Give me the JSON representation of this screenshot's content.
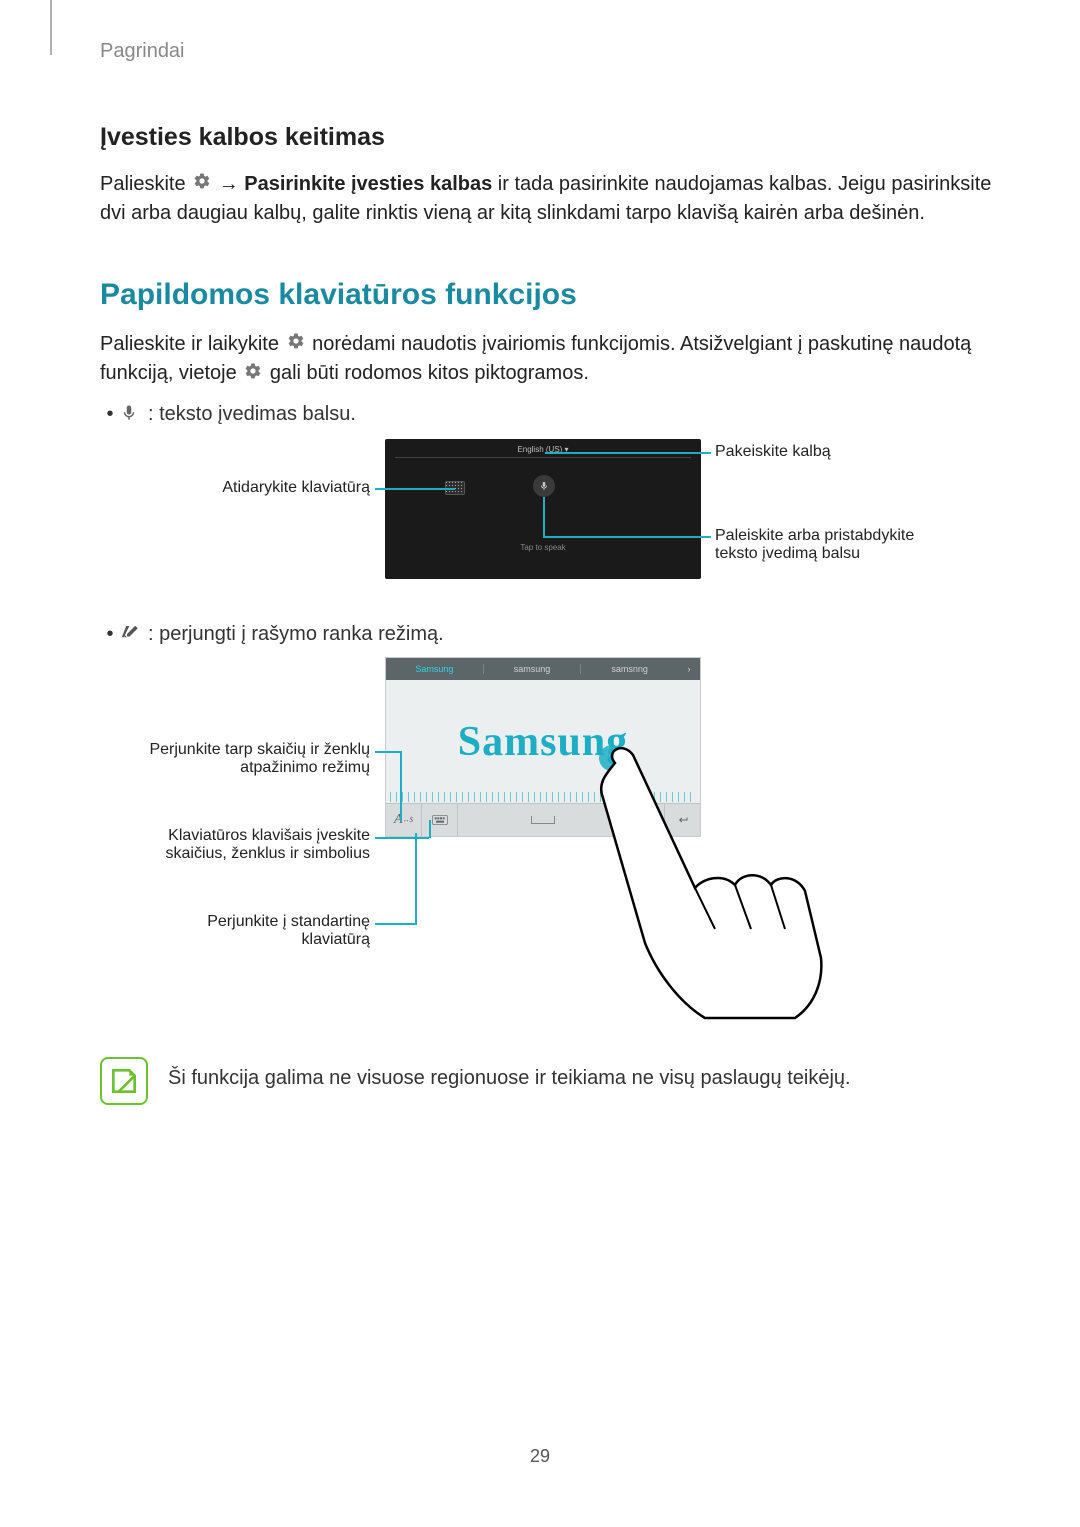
{
  "header": "Pagrindai",
  "section1_title": "Įvesties kalbos keitimas",
  "section1_p1_a": "Palieskite ",
  "section1_p1_b": " → ",
  "section1_p1_bold": "Pasirinkite įvesties kalbas",
  "section1_p1_c": " ir tada pasirinkite naudojamas kalbas. Jeigu pasirinksite dvi arba daugiau kalbų, galite rinktis vieną ar kitą slinkdami tarpo klavišą kairėn arba dešinėn.",
  "section2_title": "Papildomos klaviatūros funkcijos",
  "section2_p1_a": "Palieskite ir laikykite ",
  "section2_p1_b": " norėdami naudotis įvairiomis funkcijomis. Atsižvelgiant į paskutinę naudotą funkciją, vietoje ",
  "section2_p1_c": " gali būti rodomos kitos piktogramos.",
  "bullet1": " : teksto įvedimas balsu.",
  "bullet2": " : perjungti į rašymo ranka režimą.",
  "dark_panel": {
    "lang": "English (US)  ▾",
    "tap": "Tap to speak"
  },
  "d1_callouts": {
    "open_kbd": "Atidarykite klaviatūrą",
    "change_lang": "Pakeiskite kalbą",
    "start_stop": "Paleiskite arba pristabdykite teksto įvedimą balsu"
  },
  "hw_panel": {
    "sugg1": "Samsung",
    "sugg2": "samsung",
    "sugg3": "samsnng",
    "written": "Samsung"
  },
  "d2_callouts": {
    "switch_num": "Perjunkite tarp skaičių ir ženklų atpažinimo režimų",
    "kbd_keys": "Klaviatūros klavišais įveskite skaičius, ženklus ir simbolius",
    "std_kbd": "Perjunkite į standartinę klaviatūrą"
  },
  "note": "Ši funkcija galima ne visuose regionuose ir teikiama ne visų paslaugų teikėjų.",
  "page_num": "29"
}
